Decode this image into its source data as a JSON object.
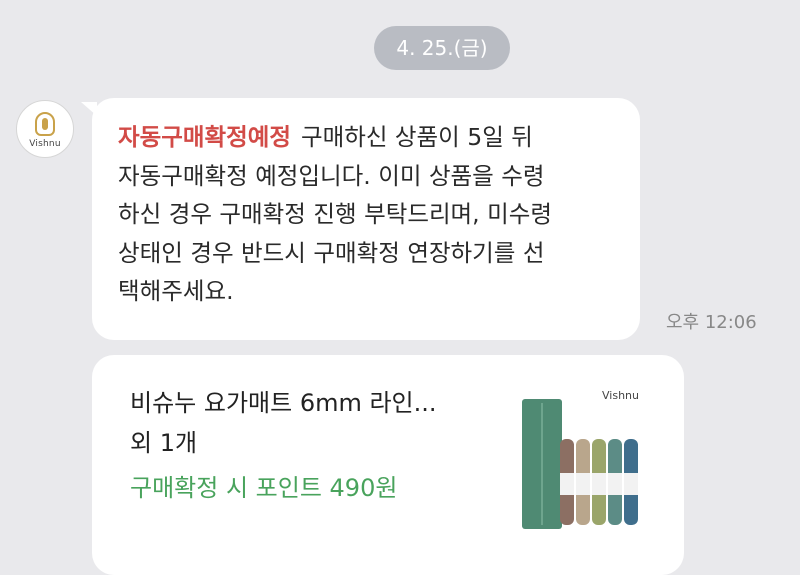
{
  "chat": {
    "date": "4. 25.(금)",
    "sender": {
      "name": "Vishnu",
      "avatar_icon": "vishnu-logo-icon"
    },
    "message": {
      "tag": "자동구매확정예정",
      "text": "구매하신 상품이 5일 뒤\n자동구매확정 예정입니다. 이미 상품을 수령\n하신 경우 구매확정 진행 부탁드리며, 미수령\n상태인 경우 반드시 구매확정 연장하기를 선\n택해주세요.",
      "time": "오후 12:06"
    },
    "product_card": {
      "title": "비슈누 요가매트 6mm 라인...\n외 1개",
      "points": "구매확정 시 포인트 490원",
      "thumbnail_brand": "Vishnu",
      "mat_colors": [
        "#4f8a73",
        "#8c6f63",
        "#b9a68c",
        "#9aa56a",
        "#5c8c86",
        "#3f6e8c"
      ]
    }
  }
}
